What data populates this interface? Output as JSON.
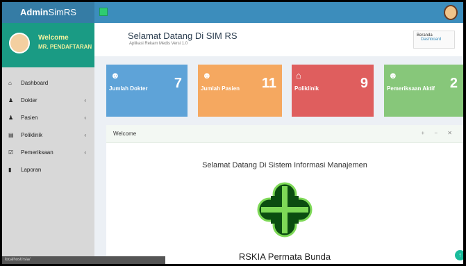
{
  "brand": {
    "bold": "Admin",
    "rest": "SimRS"
  },
  "user_panel": {
    "welcome": "Welcome",
    "role": "MR. PENDAFTARAN"
  },
  "sidebar": {
    "items": [
      {
        "label": "Dashboard",
        "icon": "dashboard-icon",
        "glyph": "⌂",
        "has_chevron": false
      },
      {
        "label": "Dokter",
        "icon": "user-icon",
        "glyph": "♟",
        "has_chevron": true
      },
      {
        "label": "Pasien",
        "icon": "user-icon",
        "glyph": "♟",
        "has_chevron": true
      },
      {
        "label": "Poliklinik",
        "icon": "list-icon",
        "glyph": "▤",
        "has_chevron": true
      },
      {
        "label": "Pemeriksaan",
        "icon": "check-icon",
        "glyph": "☑",
        "has_chevron": true
      },
      {
        "label": "Laporan",
        "icon": "book-icon",
        "glyph": "▮",
        "has_chevron": false
      }
    ],
    "chevron": "‹"
  },
  "header": {
    "title": "Selamat Datang Di SIM RS",
    "subtitle": "Aplikasi Rekam Medis Versi 1.0",
    "breadcrumb": [
      "Beranda",
      "Dashboard"
    ]
  },
  "stats": [
    {
      "label": "Jumlah Dokter",
      "value": "7",
      "icon": "users-icon",
      "glyph": "☻"
    },
    {
      "label": "Jumlah Pasien",
      "value": "11",
      "icon": "users-icon",
      "glyph": "☻"
    },
    {
      "label": "Poliklinik",
      "value": "9",
      "icon": "home-icon",
      "glyph": "⌂"
    },
    {
      "label": "Pemeriksaan Aktif",
      "value": "2",
      "icon": "users-icon",
      "glyph": "☻"
    }
  ],
  "panel": {
    "title": "Welcome",
    "tools": "+ − ✕",
    "welcome_text": "Selamat Datang Di Sistem Informasi Manajemen",
    "hospital_name": "RSKIA Permata Bunda"
  },
  "status_url": "localhost/rsia/",
  "scroll_top_glyph": "↑",
  "colors": {
    "navbar": "#3c8dbc",
    "user_panel": "#1a9b84",
    "logo_green": "#0b4d10",
    "logo_light": "#7ed957"
  }
}
